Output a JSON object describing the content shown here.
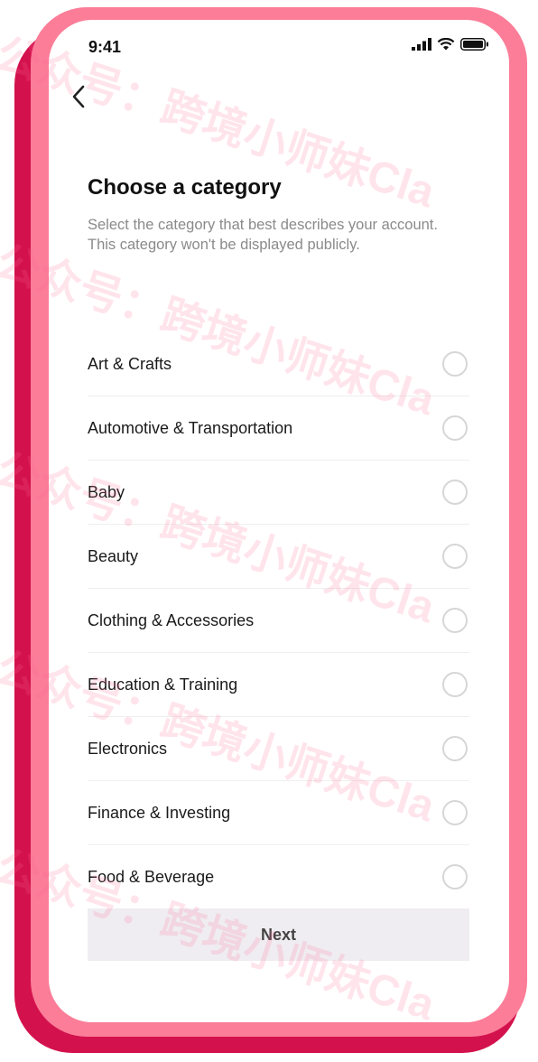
{
  "status_bar": {
    "time": "9:41"
  },
  "header": {
    "title": "Choose a category",
    "subtitle": "Select the category that best describes your account. This category won't be displayed publicly."
  },
  "categories": [
    {
      "label": "Art & Crafts",
      "selected": false
    },
    {
      "label": "Automotive & Transportation",
      "selected": false
    },
    {
      "label": "Baby",
      "selected": false
    },
    {
      "label": "Beauty",
      "selected": false
    },
    {
      "label": "Clothing & Accessories",
      "selected": false
    },
    {
      "label": "Education & Training",
      "selected": false
    },
    {
      "label": "Electronics",
      "selected": false
    },
    {
      "label": "Finance & Investing",
      "selected": false
    },
    {
      "label": "Food & Beverage",
      "selected": false
    }
  ],
  "footer": {
    "next_label": "Next"
  },
  "watermark": {
    "text": "公众号：跨境小师妹Cla"
  },
  "colors": {
    "frame_outer": "#d3124d",
    "frame_inner": "#fb7d98",
    "button_bg": "#efedf1"
  }
}
